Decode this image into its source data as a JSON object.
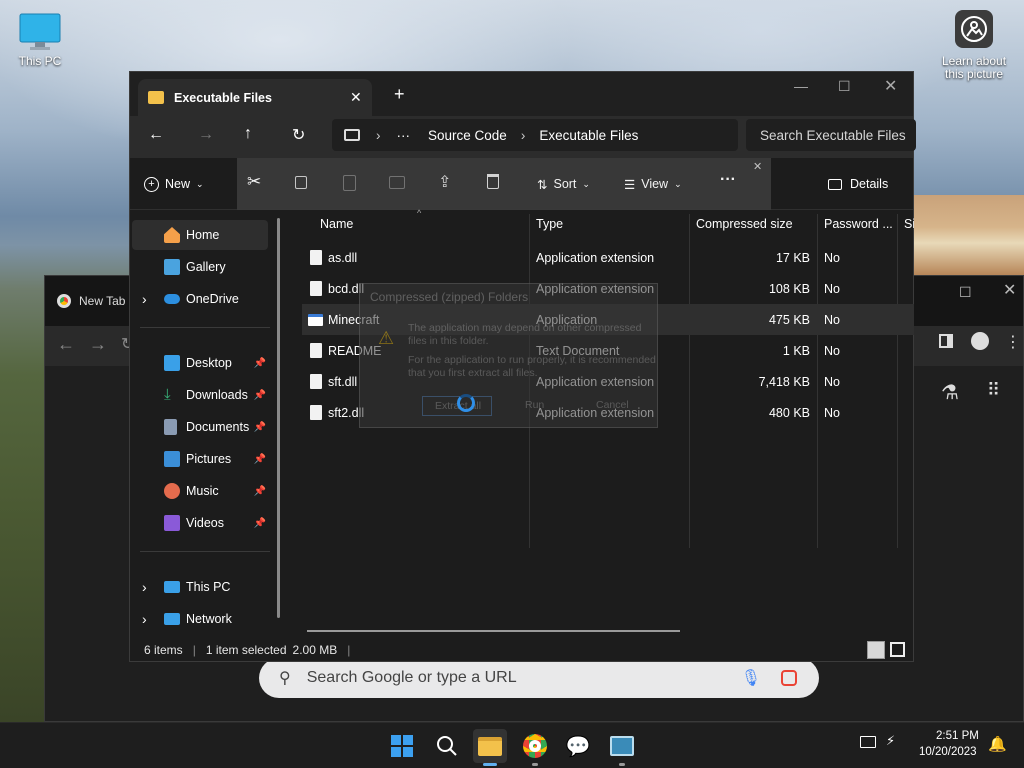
{
  "desktop": {
    "this_pc_label": "This PC",
    "learn_label_1": "Learn about",
    "learn_label_2": "this picture"
  },
  "chrome": {
    "tab_label": "New Tab",
    "omnibox_placeholder": "Search Google or type a URL"
  },
  "explorer": {
    "tab_title": "Executable Files",
    "breadcrumb": {
      "root": "Source Code",
      "current": "Executable Files"
    },
    "search_placeholder": "Search Executable Files",
    "toolbar": {
      "new_label": "New",
      "sort_label": "Sort",
      "view_label": "View",
      "details_label": "Details"
    },
    "sidebar": {
      "items": [
        {
          "label": "Home",
          "icon": "home-icon",
          "color": "#f5a04a",
          "pinned": false
        },
        {
          "label": "Gallery",
          "icon": "gallery-icon",
          "color": "#4aa3df",
          "pinned": false
        },
        {
          "label": "OneDrive",
          "icon": "cloud-icon",
          "color": "#2c8fe0",
          "pinned": false
        },
        {
          "label": "Desktop",
          "icon": "desktop-icon",
          "color": "#3aa0e8",
          "pinned": true
        },
        {
          "label": "Downloads",
          "icon": "download-icon",
          "color": "#39b47a",
          "pinned": true
        },
        {
          "label": "Documents",
          "icon": "document-icon",
          "color": "#8a9bb3",
          "pinned": true
        },
        {
          "label": "Pictures",
          "icon": "picture-icon",
          "color": "#3b8fd8",
          "pinned": true
        },
        {
          "label": "Music",
          "icon": "music-icon",
          "color": "#e46b4d",
          "pinned": true
        },
        {
          "label": "Videos",
          "icon": "video-icon",
          "color": "#8a5ad8",
          "pinned": true
        },
        {
          "label": "This PC",
          "icon": "computer-icon",
          "color": "#3aa0e8",
          "pinned": false
        },
        {
          "label": "Network",
          "icon": "network-icon",
          "color": "#3aa0e8",
          "pinned": false
        }
      ]
    },
    "columns": [
      "Name",
      "Type",
      "Compressed size",
      "Password ...",
      "Si"
    ],
    "files": [
      {
        "name": "as.dll",
        "type": "Application extension",
        "size": "17 KB",
        "password": "No"
      },
      {
        "name": "bcd.dll",
        "type": "Application extension",
        "size": "108 KB",
        "password": "No"
      },
      {
        "name": "Minecraft",
        "type": "Application",
        "size": "475 KB",
        "password": "No"
      },
      {
        "name": "README",
        "type": "Text Document",
        "size": "1 KB",
        "password": "No"
      },
      {
        "name": "sft.dll",
        "type": "Application extension",
        "size": "7,418 KB",
        "password": "No"
      },
      {
        "name": "sft2.dll",
        "type": "Application extension",
        "size": "480 KB",
        "password": "No"
      }
    ],
    "status": {
      "count": "6 items",
      "selection": "1 item selected",
      "size": "2.00 MB"
    }
  },
  "dialog": {
    "title": "Compressed (zipped) Folders",
    "message_1": "The application may depend on other compressed",
    "message_2": "files in this folder.",
    "message_3": "For the application to run properly, it is recommended",
    "message_4": "that you first extract all files.",
    "extract_label": "Extract all",
    "run_label": "Run",
    "cancel_label": "Cancel"
  },
  "taskbar": {
    "time": "2:51 PM",
    "date": "10/20/2023"
  }
}
